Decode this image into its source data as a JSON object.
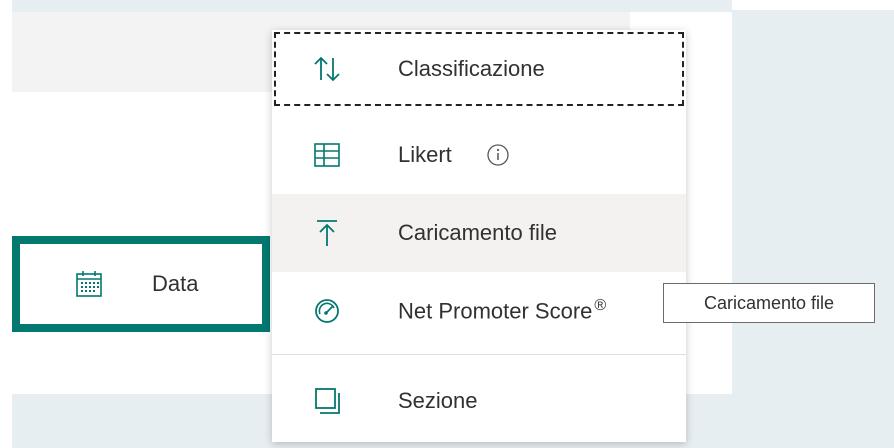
{
  "form": {
    "question_type_button": {
      "label": "Data",
      "icon": "calendar-icon"
    }
  },
  "menu": {
    "items": [
      {
        "label": "Classificazione",
        "icon": "ranking-icon",
        "state": "focused"
      },
      {
        "label": "Likert",
        "icon": "likert-grid-icon",
        "info_icon": "info-icon"
      },
      {
        "label": "Caricamento file",
        "icon": "upload-icon",
        "state": "hovered"
      },
      {
        "label": "Net Promoter Score",
        "suffix": "®",
        "icon": "gauge-icon"
      },
      {
        "label": "Sezione",
        "icon": "section-icon"
      }
    ]
  },
  "tooltip": {
    "text": "Caricamento file"
  },
  "colors": {
    "accent": "#03786f",
    "menu_hover": "#f3f2f1",
    "background": "#e7eef1"
  }
}
